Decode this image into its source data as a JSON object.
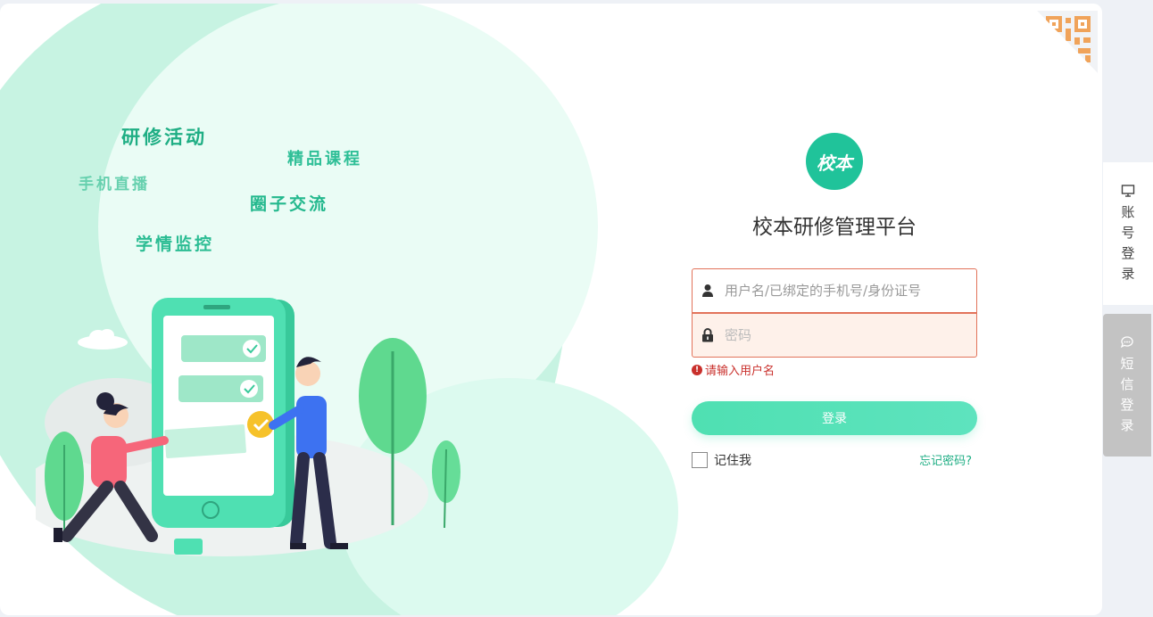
{
  "illustration": {
    "slogans": [
      "研修活动",
      "精品课程",
      "手机直播",
      "圈子交流",
      "学情监控"
    ]
  },
  "login": {
    "logo_text": "校本",
    "title": "校本研修管理平台",
    "username_placeholder": "用户名/已绑定的手机号/身份证号",
    "password_placeholder": "密码",
    "error_message": "请输入用户名",
    "login_button": "登录",
    "remember_label": "记住我",
    "forgot_link": "忘记密码?"
  },
  "side_tabs": {
    "account": "账号登录",
    "sms": "短信登录"
  },
  "colors": {
    "accent": "#20c39a",
    "error": "#c9302c",
    "field_border": "#e2735a"
  },
  "icons": [
    "user-icon",
    "lock-icon",
    "error-icon",
    "qr-code-icon",
    "monitor-icon",
    "chat-icon"
  ]
}
